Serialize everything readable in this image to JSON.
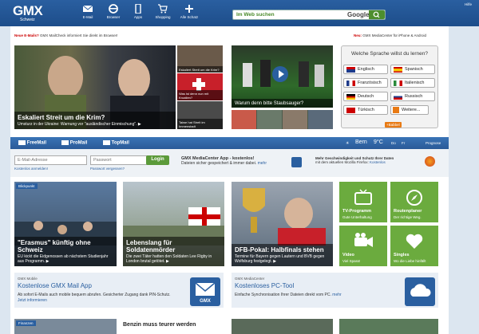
{
  "header": {
    "logo": "GMX",
    "logo_sub": "Schweiz",
    "nav": [
      {
        "label": "E-Mail",
        "icon": "mail-icon"
      },
      {
        "label": "Browser",
        "icon": "browser-icon"
      },
      {
        "label": "Apps",
        "icon": "phone-icon"
      },
      {
        "label": "Shopping",
        "icon": "cart-icon"
      },
      {
        "label": "Alle Schatz",
        "icon": "plus-icon"
      }
    ],
    "search_label": "Im Web suchen",
    "search_engine": "Google",
    "hilfe": "Hilfe"
  },
  "promos": {
    "left_bold": "Neue E-Mails?",
    "left_text": "GMX MailCheck informiert Sie direkt im Browser!",
    "right_bold": "Neu:",
    "right_text": "GMX MediaCenter für iPhone & Android"
  },
  "hero": {
    "title": "Eskaliert Streit um die Krim?",
    "sub": "Umsturz in der Ukraine: Warnung vor \"ausländischer Einmischung\". ▶",
    "thumbs": [
      {
        "title": "Eskaliert Streit um die Krim?"
      },
      {
        "title": "Was ist denn nun mit Kroatien?"
      },
      {
        "title": "Taiwe hat Streit im Immenstadt"
      }
    ]
  },
  "video": {
    "title": "Warum denn bitte Staubsauger?"
  },
  "language": {
    "question": "Welche Sprache willst du lernen?",
    "options": [
      "Englisch",
      "Spanisch",
      "Französisch",
      "Italienisch",
      "Deutsch",
      "Russisch",
      "Türkisch",
      "Weitere..."
    ],
    "brand": "+Babbel"
  },
  "login": {
    "tabs": [
      "FreeMail",
      "ProMail",
      "TopMail"
    ],
    "email_placeholder": "E-Mail-Adresse",
    "password_placeholder": "Passwort",
    "login_button": "Login",
    "link_login": "Kostenlos anmelden!",
    "link_forgot": "Passwort vergessen?",
    "app_promo_title": "GMX MediaCenter App - kostenlos!",
    "app_promo_text": "Dateien sicher gespeichert & immer dabei.",
    "app_promo_more": "mehr",
    "firefox_title": "Mehr Geschwindigkeit und Schutz Ihrer Daten",
    "firefox_text": "mit dem aktuellen Mozilla Firefox:",
    "firefox_link": "Kostenlos",
    "weather_city": "Bern",
    "weather_temp": "9°C",
    "weather_days": "Do",
    "weather_fr": "Fr",
    "weather_prog": "Prognose"
  },
  "news": {
    "section": "Blickpunkt",
    "items": [
      {
        "title": "\"Erasmus\" künftig ohne Schweiz",
        "sub": "EU kickt die Eidgenossen ab nächstem Studienjahr aus Programm. ▶"
      },
      {
        "title": "Lebenslang für Soldatenmörder",
        "sub": "Die zwei Täter hatten den Soldaten Lee Rigby in London brutal getötet. ▶"
      },
      {
        "title": "DFB-Pokal: Halbfinals stehen",
        "sub": "Termine für Bayern gegen Lautern und BVB gegen Wolfsburg festgelegt. ▶"
      }
    ]
  },
  "services": [
    {
      "title": "TV-Programm",
      "sub": "Gute Unterhaltung",
      "icon": "tv-icon"
    },
    {
      "title": "Routenplaner",
      "sub": "Der richtige Weg.",
      "icon": "compass-icon"
    },
    {
      "title": "Video",
      "sub": "Viel Spass!",
      "icon": "video-camera-icon"
    },
    {
      "title": "Singles",
      "sub": "Wo die Liebe hinfällt",
      "icon": "heart-icon"
    }
  ],
  "banners": [
    {
      "kicker": "GMX Mobile",
      "title": "Kostenlose GMX Mail App",
      "text": "Ab sofort E-Mails auch mobile bequem abrufen. Gesicherter Zugang dank PIN-Schutz.",
      "link": "Jetzt informieren",
      "icon": "gmx-mail-icon"
    },
    {
      "kicker": "GMX MediaCenter",
      "title": "Kostenloses PC-Tool",
      "text": "Einfache Synchronisation Ihrer Dateien direkt vom PC.",
      "link": "mehr",
      "icon": "cloud-icon"
    }
  ],
  "bottom": {
    "section": "Finanzen",
    "headline": "Benzin muss teurer werden"
  }
}
